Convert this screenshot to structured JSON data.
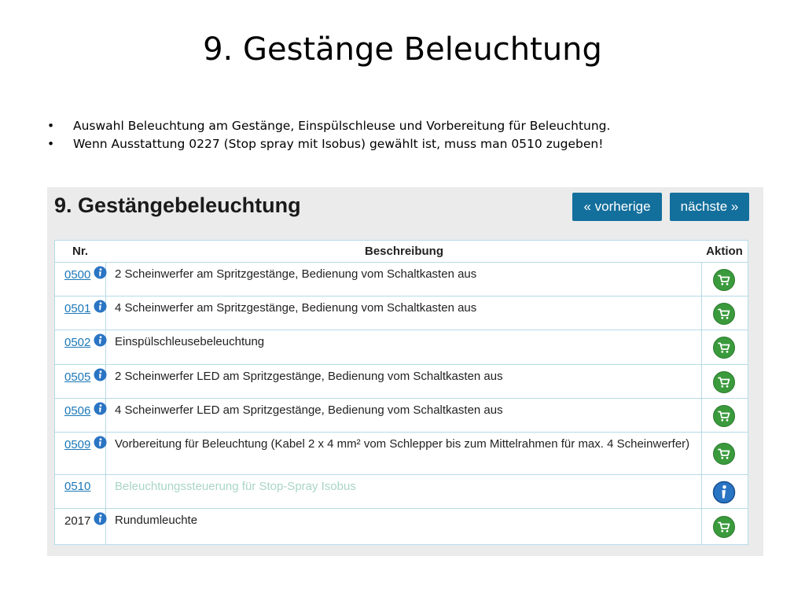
{
  "slide": {
    "title": "9. Gestänge Beleuchtung",
    "bullet_symbol": "•",
    "bullets": [
      "Auswahl Beleuchtung am Gestänge, Einspülschleuse und Vorbereitung für Beleuchtung.",
      "Wenn Ausstattung 0227 (Stop spray mit Isobus) gewählt ist, muss man 0510 zugeben!"
    ]
  },
  "panel": {
    "title": "9. Gestängebeleuchtung",
    "prev_label": "« vorherige",
    "next_label": "nächste »"
  },
  "table": {
    "headers": {
      "nr": "Nr.",
      "desc": "Beschreibung",
      "action": "Aktion"
    },
    "rows": [
      {
        "nr": "0500",
        "desc": "2 Scheinwerfer am Spritzgestänge, Bedienung vom Schaltkasten aus"
      },
      {
        "nr": "0501",
        "desc": "4 Scheinwerfer am Spritzgestänge, Bedienung vom Schaltkasten aus"
      },
      {
        "nr": "0502",
        "desc": "Einspülschleusebeleuchtung"
      },
      {
        "nr": "0505",
        "desc": "2 Scheinwerfer LED am Spritzgestänge, Bedienung vom Schaltkasten aus"
      },
      {
        "nr": "0506",
        "desc": "4 Scheinwerfer LED am Spritzgestänge, Bedienung vom Schaltkasten aus"
      },
      {
        "nr": "0509",
        "desc": "Vorbereitung für Beleuchtung (Kabel 2 x 4 mm² vom Schlepper bis zum Mittelrahmen für max. 4 Scheinwerfer)"
      },
      {
        "nr": "0510",
        "desc": "Beleuchtungssteuerung für Stop-Spray Isobus"
      },
      {
        "nr": "2017",
        "desc": "Rundumleuchte"
      }
    ]
  },
  "icons": {
    "info": "info-icon",
    "cart": "cart-icon"
  },
  "colors": {
    "button_bg": "#136f9c",
    "link": "#1c78b8",
    "cart_green": "#3a9a3c",
    "info_blue": "#2a74c4",
    "muted_text": "#a9d5c6",
    "table_border": "#b6dbe8",
    "panel_bg": "#ebebeb"
  }
}
